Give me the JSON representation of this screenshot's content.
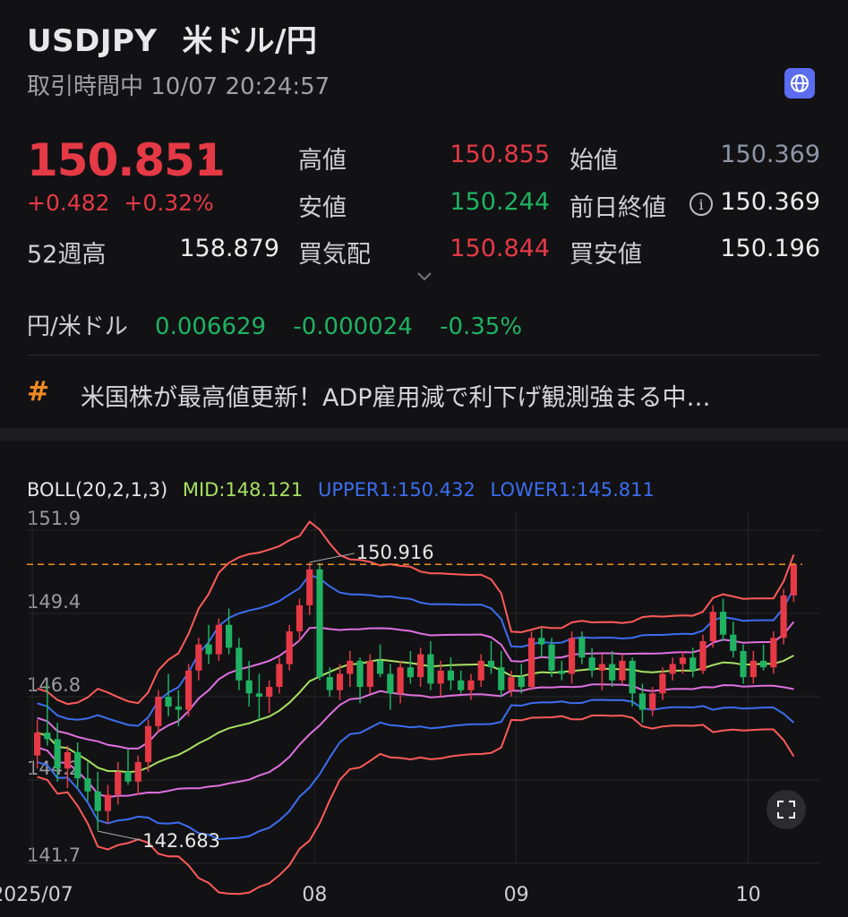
{
  "header": {
    "symbol": "USDJPY",
    "name": "米ドル/円",
    "status": "取引時間中 10/07 20:24:57",
    "globe_icon": "globe-icon"
  },
  "quote": {
    "price": "150.851",
    "arrow": "↑",
    "change": "+0.482  +0.32%",
    "week52_high_label": "52週高",
    "week52_high": "158.879",
    "high_label": "高値",
    "high": "150.855",
    "low_label": "安値",
    "low": "150.244",
    "bid_label": "買気配",
    "bid": "150.844",
    "open_label": "始値",
    "open": "150.369",
    "prev_close_label": "前日終値",
    "prev_close": "150.369",
    "buy_low_label": "買安値",
    "buy_low": "150.196"
  },
  "conversion": {
    "label": "円/米ドル",
    "value": "0.006629",
    "change": "-0.000024",
    "pct": "-0.35%"
  },
  "news": {
    "icon": "hashtag-icon",
    "text": "米国株が最高値更新！ADP雇用減で利下げ観測強まる中…"
  },
  "colors": {
    "up": "#e63946",
    "down": "#1fb262",
    "mid": "#a8e063",
    "band1": "#3d6df0",
    "band2": "#e070e0",
    "band3": "#ff5a5a",
    "last_price_line": "#f08a24"
  },
  "chart_data": {
    "type": "candlestick",
    "indicator": "BOLL(20,2,1,3)",
    "mid_label": "MID:148.121",
    "upper_label": "UPPER1:150.432",
    "lower_label": "LOWER1:145.811",
    "y_ticks": [
      "151.9",
      "149.4",
      "146.8",
      "144.2",
      "141.7"
    ],
    "x_ticks": [
      "2025/07",
      "08",
      "09",
      "10"
    ],
    "ylim": [
      141.7,
      151.9
    ],
    "max_annotation": "150.916",
    "min_annotation": "142.683",
    "last_price": 150.851,
    "candles": [
      [
        145.0,
        146.1,
        144.6,
        145.7
      ],
      [
        145.7,
        147.2,
        145.3,
        145.5
      ],
      [
        145.5,
        146.0,
        144.2,
        144.6
      ],
      [
        144.6,
        145.3,
        144.0,
        145.1
      ],
      [
        145.1,
        145.4,
        144.0,
        144.3
      ],
      [
        144.3,
        144.8,
        143.6,
        143.9
      ],
      [
        143.9,
        144.5,
        142.7,
        143.3
      ],
      [
        143.3,
        144.1,
        142.9,
        143.8
      ],
      [
        143.8,
        144.8,
        143.5,
        144.5
      ],
      [
        144.5,
        145.2,
        144.1,
        144.2
      ],
      [
        144.2,
        145.0,
        143.8,
        144.8
      ],
      [
        144.8,
        146.1,
        144.5,
        145.9
      ],
      [
        145.9,
        147.0,
        145.7,
        146.8
      ],
      [
        146.8,
        147.5,
        146.2,
        146.5
      ],
      [
        146.5,
        147.0,
        145.9,
        146.4
      ],
      [
        146.4,
        147.8,
        146.2,
        147.6
      ],
      [
        147.6,
        148.6,
        147.3,
        148.4
      ],
      [
        148.4,
        149.0,
        147.8,
        148.1
      ],
      [
        148.1,
        149.2,
        147.9,
        149.0
      ],
      [
        149.0,
        149.5,
        148.1,
        148.3
      ],
      [
        148.3,
        148.6,
        147.0,
        147.3
      ],
      [
        147.3,
        147.9,
        146.5,
        146.9
      ],
      [
        146.9,
        147.5,
        146.1,
        146.8
      ],
      [
        146.8,
        147.3,
        146.3,
        147.1
      ],
      [
        147.1,
        148.0,
        146.9,
        147.8
      ],
      [
        147.8,
        149.0,
        147.6,
        148.8
      ],
      [
        148.8,
        149.8,
        148.5,
        149.6
      ],
      [
        149.6,
        150.9,
        149.3,
        150.7
      ],
      [
        150.7,
        150.9,
        147.3,
        147.4
      ],
      [
        147.4,
        147.7,
        146.8,
        147.0
      ],
      [
        147.0,
        147.8,
        146.7,
        147.5
      ],
      [
        147.5,
        148.2,
        147.1,
        147.9
      ],
      [
        147.9,
        148.0,
        146.6,
        147.1
      ],
      [
        147.1,
        148.1,
        146.9,
        147.9
      ],
      [
        147.9,
        148.4,
        147.4,
        147.5
      ],
      [
        147.5,
        147.8,
        146.4,
        146.9
      ],
      [
        146.9,
        147.9,
        146.6,
        147.7
      ],
      [
        147.7,
        148.2,
        147.2,
        147.4
      ],
      [
        147.4,
        148.3,
        147.1,
        148.1
      ],
      [
        148.1,
        148.5,
        147.0,
        147.2
      ],
      [
        147.2,
        147.9,
        146.8,
        147.6
      ],
      [
        147.6,
        148.0,
        147.0,
        147.3
      ],
      [
        147.3,
        147.6,
        146.9,
        147.0
      ],
      [
        147.0,
        147.5,
        146.7,
        147.3
      ],
      [
        147.3,
        148.1,
        147.1,
        147.9
      ],
      [
        147.9,
        148.5,
        147.5,
        147.7
      ],
      [
        147.7,
        148.2,
        146.8,
        147.0
      ],
      [
        147.0,
        147.6,
        146.8,
        147.4
      ],
      [
        147.4,
        147.8,
        146.9,
        147.1
      ],
      [
        147.1,
        148.8,
        147.0,
        148.6
      ],
      [
        148.6,
        148.9,
        148.0,
        148.4
      ],
      [
        148.4,
        148.6,
        147.4,
        147.6
      ],
      [
        147.6,
        147.9,
        147.3,
        147.5
      ],
      [
        147.5,
        148.8,
        147.2,
        148.6
      ],
      [
        148.6,
        148.8,
        147.8,
        148.0
      ],
      [
        148.0,
        148.3,
        147.4,
        147.6
      ],
      [
        147.6,
        148.1,
        147.0,
        147.8
      ],
      [
        147.8,
        148.2,
        147.1,
        147.3
      ],
      [
        147.3,
        148.1,
        147.2,
        147.9
      ],
      [
        147.9,
        148.0,
        146.5,
        146.9
      ],
      [
        146.9,
        147.2,
        146.0,
        146.4
      ],
      [
        146.4,
        147.1,
        146.2,
        146.9
      ],
      [
        146.9,
        147.7,
        146.7,
        147.5
      ],
      [
        147.5,
        148.0,
        147.3,
        147.8
      ],
      [
        147.8,
        148.2,
        147.5,
        148.0
      ],
      [
        148.0,
        148.3,
        147.4,
        147.6
      ],
      [
        147.6,
        148.7,
        147.5,
        148.5
      ],
      [
        148.5,
        149.6,
        148.3,
        149.4
      ],
      [
        149.4,
        149.8,
        148.5,
        148.7
      ],
      [
        148.7,
        149.1,
        148.0,
        148.2
      ],
      [
        148.2,
        148.4,
        147.2,
        147.4
      ],
      [
        147.4,
        148.2,
        147.2,
        147.9
      ],
      [
        147.9,
        148.4,
        147.6,
        147.7
      ],
      [
        147.7,
        148.8,
        147.5,
        148.6
      ],
      [
        148.6,
        150.1,
        148.4,
        149.9
      ],
      [
        149.9,
        150.9,
        149.7,
        150.85
      ]
    ]
  },
  "fullscreen_icon": "fullscreen-icon"
}
